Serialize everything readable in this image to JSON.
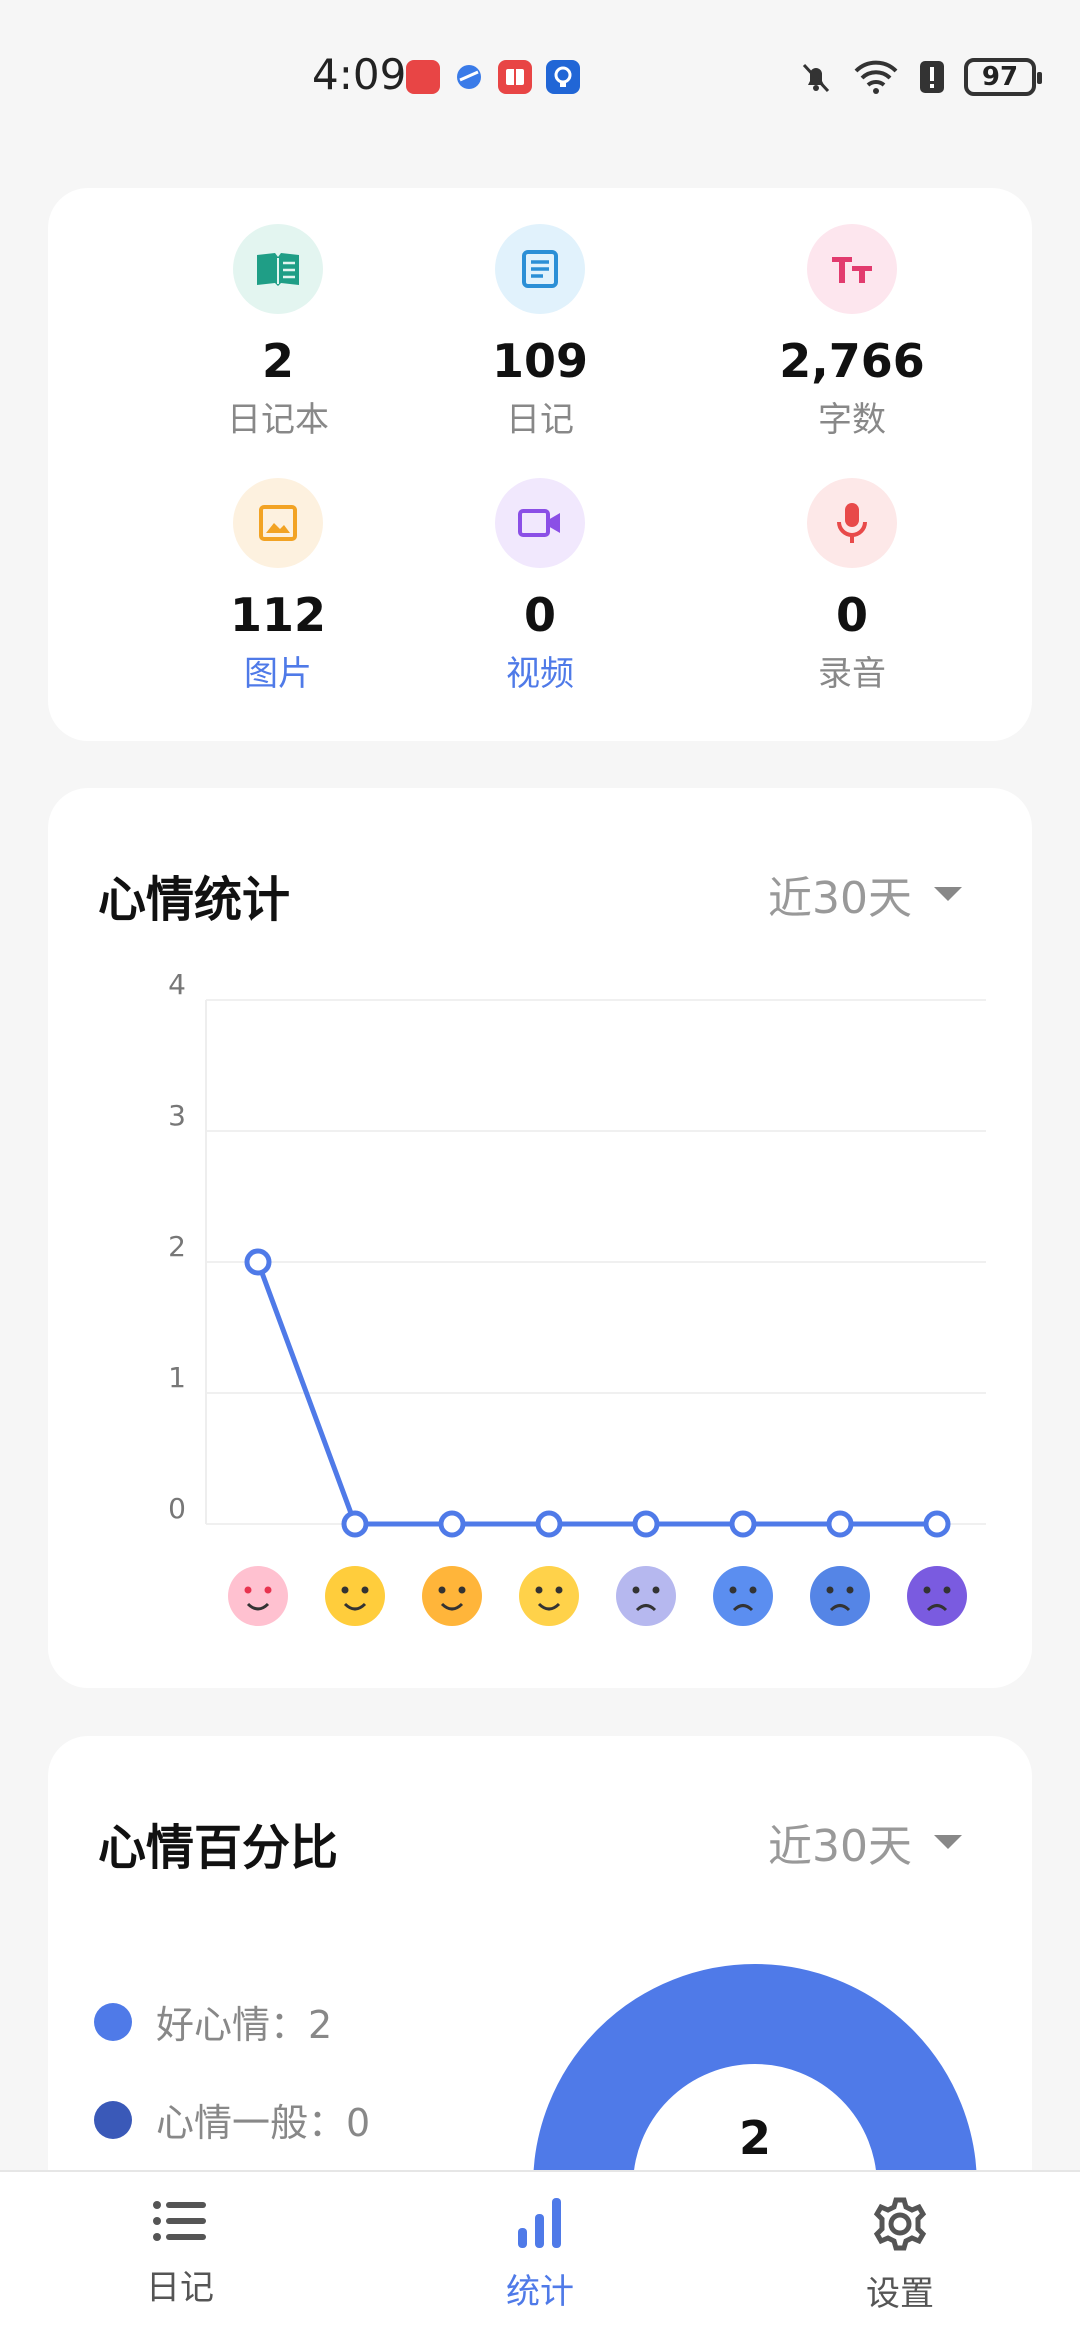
{
  "status_bar": {
    "time": "4:09",
    "battery": "97",
    "icons": [
      "huawei-appgallery-icon",
      "browser-icon",
      "reader-icon",
      "tips-icon",
      "mute-icon",
      "wifi-icon",
      "alert-icon"
    ]
  },
  "summary": {
    "items": [
      {
        "value": "2",
        "label": "日记本",
        "icon": "book-icon",
        "color": "#1f9e86",
        "bg": "#e3f5f0",
        "link": false
      },
      {
        "value": "109",
        "label": "日记",
        "icon": "document-icon",
        "color": "#2b8fd6",
        "bg": "#e1f2fc",
        "link": false
      },
      {
        "value": "2,766",
        "label": "字数",
        "icon": "text-size-icon",
        "color": "#e23b6e",
        "bg": "#fde6ee",
        "link": false
      },
      {
        "value": "112",
        "label": "图片",
        "icon": "image-icon",
        "color": "#f2a324",
        "bg": "#fdf1df",
        "link": true
      },
      {
        "value": "0",
        "label": "视频",
        "icon": "video-icon",
        "color": "#8b4fe6",
        "bg": "#f1e8fd",
        "link": true
      },
      {
        "value": "0",
        "label": "录音",
        "icon": "microphone-icon",
        "color": "#e84a4a",
        "bg": "#fde8e8",
        "link": false
      }
    ]
  },
  "mood_stats": {
    "title": "心情统计",
    "range": "近30天"
  },
  "chart_data": {
    "type": "line",
    "categories": [
      "loved-face-icon",
      "grinning-face-icon",
      "smiling-face-icon",
      "calm-face-icon",
      "worried-face-icon",
      "angry-face-icon",
      "sad-face-icon",
      "crying-face-icon"
    ],
    "values": [
      2,
      0,
      0,
      0,
      0,
      0,
      0,
      0
    ],
    "yticks": [
      "0",
      "1",
      "2",
      "3",
      "4"
    ],
    "ylim": [
      0,
      4
    ],
    "grid": true,
    "line_color": "#4f7ae8",
    "emoji_colors": [
      "#ffc1d0",
      "#ffcd3c",
      "#ffb53a",
      "#ffd24a",
      "#b6b8ef",
      "#5b8ef0",
      "#5585e6",
      "#7a5be0"
    ]
  },
  "mood_percent": {
    "title": "心情百分比",
    "range": "近30天",
    "legend": [
      {
        "label": "好心情：2",
        "color": "#4f7ae8"
      },
      {
        "label": "心情一般：0",
        "color": "#3a59b8"
      }
    ],
    "donut_center": "2",
    "donut_color": "#4f7ae8"
  },
  "tab_bar": {
    "tabs": [
      {
        "label": "日记",
        "icon": "list-icon",
        "active": false
      },
      {
        "label": "统计",
        "icon": "bar-chart-icon",
        "active": true
      },
      {
        "label": "设置",
        "icon": "gear-icon",
        "active": false
      }
    ]
  }
}
